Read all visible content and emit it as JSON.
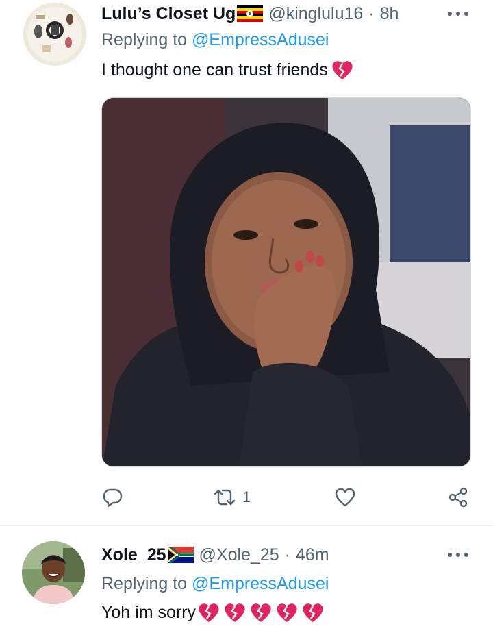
{
  "tweets": [
    {
      "display_name": "Lulu’s Closet Ug",
      "handle": "@kinglulu16",
      "separator": "·",
      "time": "8h",
      "replying_label": "Replying to",
      "replying_to": "@EmpressAdusei",
      "text": "I thought one can trust friends",
      "actions": {
        "reply_count": "",
        "retweet_count": "1",
        "like_count": ""
      }
    },
    {
      "display_name": "Xole_25",
      "handle": "@Xole_25",
      "separator": "·",
      "time": "46m",
      "replying_label": "Replying to",
      "replying_to": "@EmpressAdusei",
      "text": "Yoh im sorry"
    }
  ],
  "colors": {
    "accent": "#1d9bf0",
    "muted": "#536471",
    "text": "#0f1419",
    "broken_heart": "#e0245e"
  },
  "icons": [
    "more-icon",
    "reply-icon",
    "retweet-icon",
    "like-icon",
    "share-icon",
    "broken-heart-emoji",
    "uganda-flag",
    "south-africa-flag"
  ]
}
